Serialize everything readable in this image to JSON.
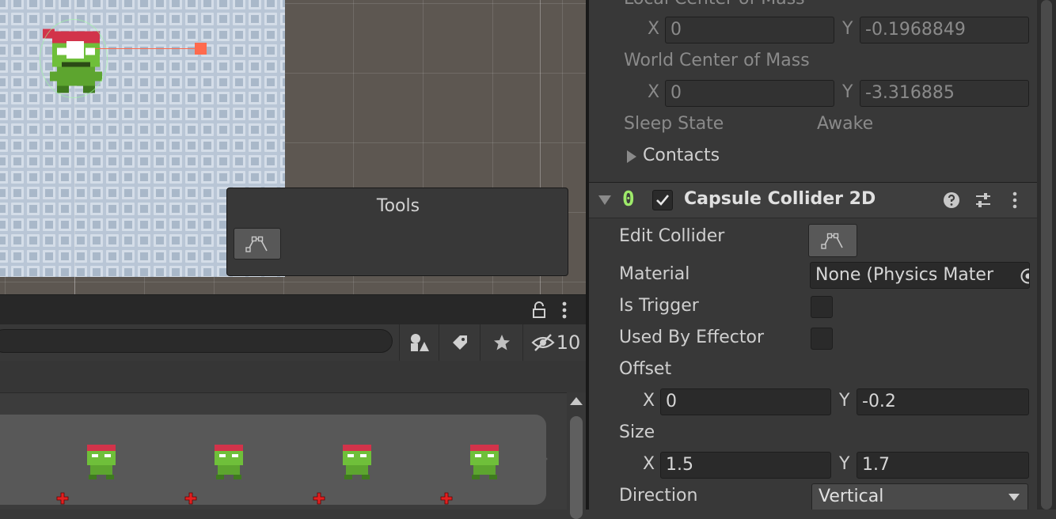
{
  "tools_panel": {
    "title": "Tools"
  },
  "hierarchy_toolbar": {
    "search_value": "",
    "hidden_count": "10"
  },
  "inspector": {
    "local_center_of_mass": {
      "label": "Local Center of Mass",
      "x": "0",
      "y": "-0.1968849"
    },
    "world_center_of_mass": {
      "label": "World Center of Mass",
      "x": "0",
      "y": "-3.316885"
    },
    "sleep_state": {
      "label": "Sleep State",
      "value": "Awake"
    },
    "contacts": {
      "label": "Contacts"
    },
    "axis_x": "X",
    "axis_y": "Y",
    "component": {
      "badge": "0",
      "title": "Capsule Collider 2D",
      "enabled": true
    },
    "edit_collider": {
      "label": "Edit Collider"
    },
    "material": {
      "label": "Material",
      "value": "None (Physics Mater"
    },
    "is_trigger": {
      "label": "Is Trigger",
      "checked": false
    },
    "used_by_effector": {
      "label": "Used By Effector",
      "checked": false
    },
    "offset": {
      "label": "Offset",
      "x": "0",
      "y": "-0.2"
    },
    "size": {
      "label": "Size",
      "x": "1.5",
      "y": "1.7"
    },
    "direction": {
      "label": "Direction",
      "value": "Vertical"
    }
  },
  "colors": {
    "scene_bg": "#5d5751",
    "tile_bg": "#b9c6d6",
    "gizmo": "#ff6a4d",
    "badge_green": "#9eea6a",
    "panel_bg": "#383838"
  },
  "icons": [
    "edit-collider-icon",
    "lock-icon",
    "kebab-menu-icon",
    "filter-by-type-icon",
    "label-tag-icon",
    "favorite-star-icon",
    "hidden-eye-icon",
    "help-icon",
    "presets-icon",
    "object-picker-icon",
    "dropdown-caret-icon",
    "add-plus-icon"
  ]
}
